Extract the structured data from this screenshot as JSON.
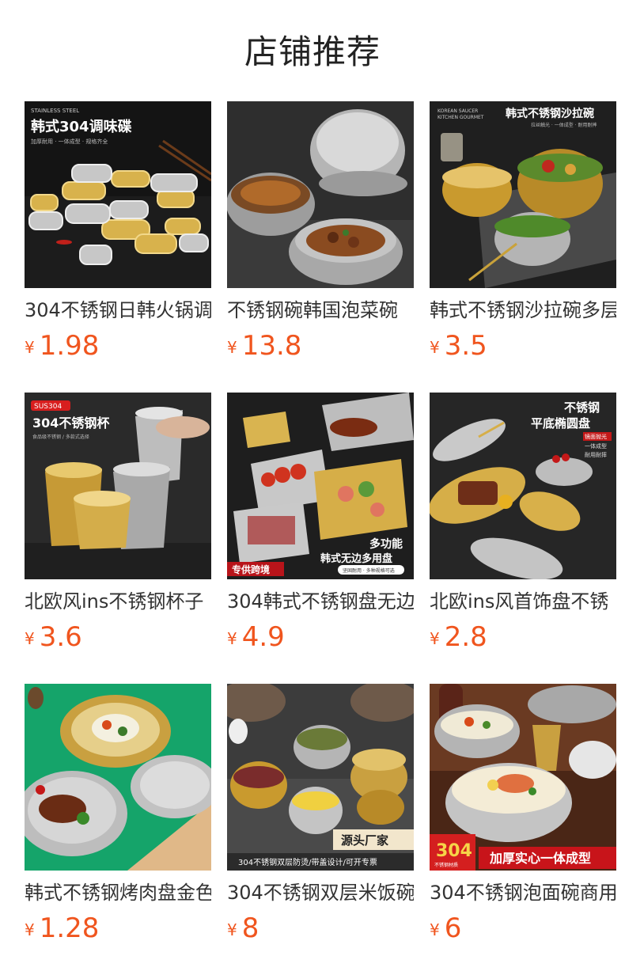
{
  "page": {
    "title": "店铺推荐"
  },
  "products": [
    {
      "name": "304不锈钢日韩火锅调",
      "currency": "¥",
      "price": "1.98",
      "image_text": [
        "STAINLESS STEEL",
        "韩式304调味碟",
        "加厚耐用 · 一体成型 · 规格齐全"
      ]
    },
    {
      "name": "不锈钢碗韩国泡菜碗",
      "currency": "¥",
      "price": "13.8",
      "image_text": []
    },
    {
      "name": "韩式不锈钢沙拉碗多层",
      "currency": "¥",
      "price": "3.5",
      "image_text": [
        "KOREAN SAUCER",
        "KITCHEN GOURMET",
        "韩式不锈钢沙拉碗",
        "拉丝触光 · 一体成型 · 耐用耐摔"
      ]
    },
    {
      "name": "北欧风ins不锈钢杯子",
      "currency": "¥",
      "price": "3.6",
      "image_text": [
        "SUS304",
        "304不锈钢杯",
        "食品级不锈钢 / 多款式选择"
      ]
    },
    {
      "name": "304韩式不锈钢盘无边",
      "currency": "¥",
      "price": "4.9",
      "image_text": [
        "多功能",
        "韩式无边多用盘",
        "专供跨境",
        "坚固耐用 · 多种规格可选"
      ]
    },
    {
      "name": "北欧ins风首饰盘不锈",
      "currency": "¥",
      "price": "2.8",
      "image_text": [
        "不锈钢",
        "平底椭圆盘",
        "镜面抛光",
        "一体成型",
        "耐用耐摔"
      ]
    },
    {
      "name": "韩式不锈钢烤肉盘金色",
      "currency": "¥",
      "price": "1.28",
      "image_text": []
    },
    {
      "name": "304不锈钢双层米饭碗",
      "currency": "¥",
      "price": "8",
      "image_text": [
        "源头厂家",
        "304不锈钢双层防烫/带盖设计/可开专票"
      ]
    },
    {
      "name": "304不锈钢泡面碗商用",
      "currency": "¥",
      "price": "6",
      "image_text": [
        "304",
        "不锈钢材质",
        "加厚实心一体成型"
      ]
    }
  ],
  "colors": {
    "price": "#f0551e",
    "title": "#222222",
    "name": "#333333",
    "gold": "#d6b04a",
    "silver": "#c9c9c9"
  }
}
